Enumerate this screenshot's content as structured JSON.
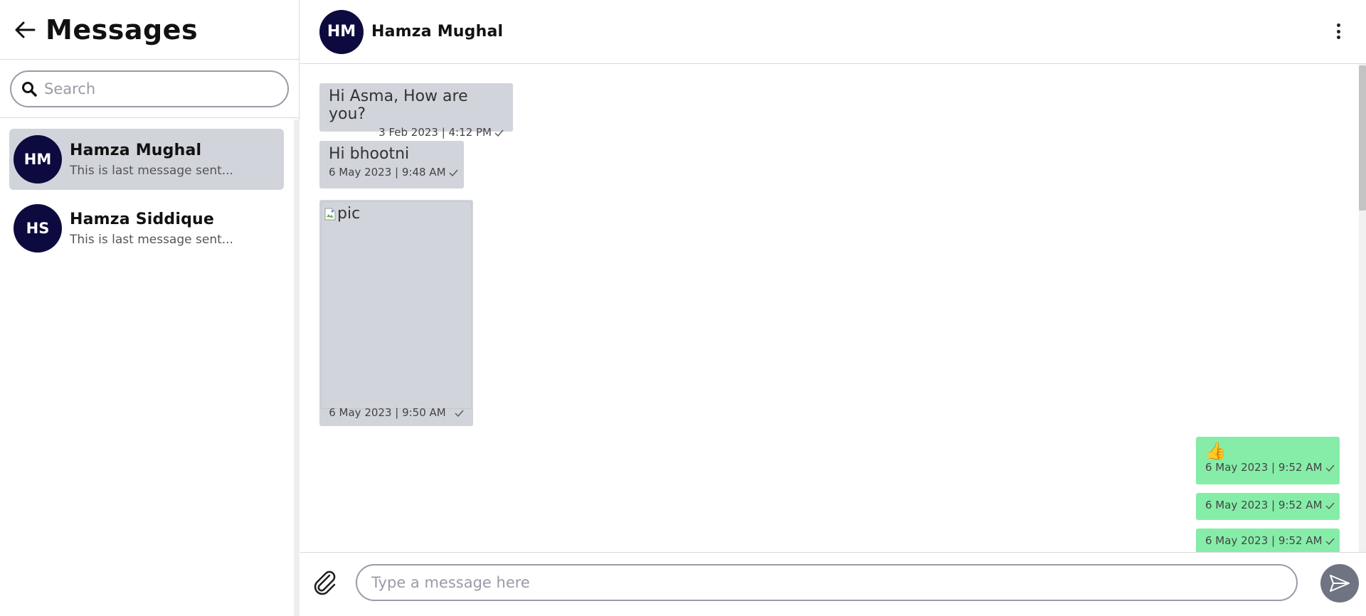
{
  "sidebar": {
    "title": "Messages",
    "search_placeholder": "Search",
    "conversations": [
      {
        "initials": "HM",
        "name": "Hamza Mughal",
        "last_message": "This is last message sent...",
        "active": true
      },
      {
        "initials": "HS",
        "name": "Hamza Siddique",
        "last_message": "This is last message sent...",
        "active": false
      }
    ]
  },
  "chat": {
    "header": {
      "initials": "HM",
      "name": "Hamza Mughal"
    },
    "messages": [
      {
        "direction": "incoming",
        "text": "Hi Asma, How are you?",
        "meta": "3 Feb 2023 | 4:12 PM"
      },
      {
        "direction": "incoming",
        "text": "Hi bhootni",
        "meta": "6 May 2023 | 9:48 AM"
      },
      {
        "direction": "incoming",
        "image_alt": "pic",
        "meta": "6 May 2023 | 9:50 AM"
      },
      {
        "direction": "outgoing",
        "text": "👍",
        "meta": "6 May 2023 | 9:52 AM"
      },
      {
        "direction": "outgoing",
        "text": "",
        "meta": "6 May 2023 | 9:52 AM"
      },
      {
        "direction": "outgoing",
        "text": "",
        "meta": "6 May 2023 | 9:52 AM"
      }
    ],
    "composer": {
      "placeholder": "Type a message here"
    }
  },
  "colors": {
    "avatar_bg": "#0c0a3e",
    "incoming_bubble": "#d2d4dc",
    "outgoing_bubble": "#86eda9",
    "send_button": "#6f7483"
  },
  "icons": [
    "arrow-left-icon",
    "search-icon",
    "kebab-menu-icon",
    "check-icon",
    "paperclip-icon",
    "send-icon",
    "broken-image-icon"
  ]
}
